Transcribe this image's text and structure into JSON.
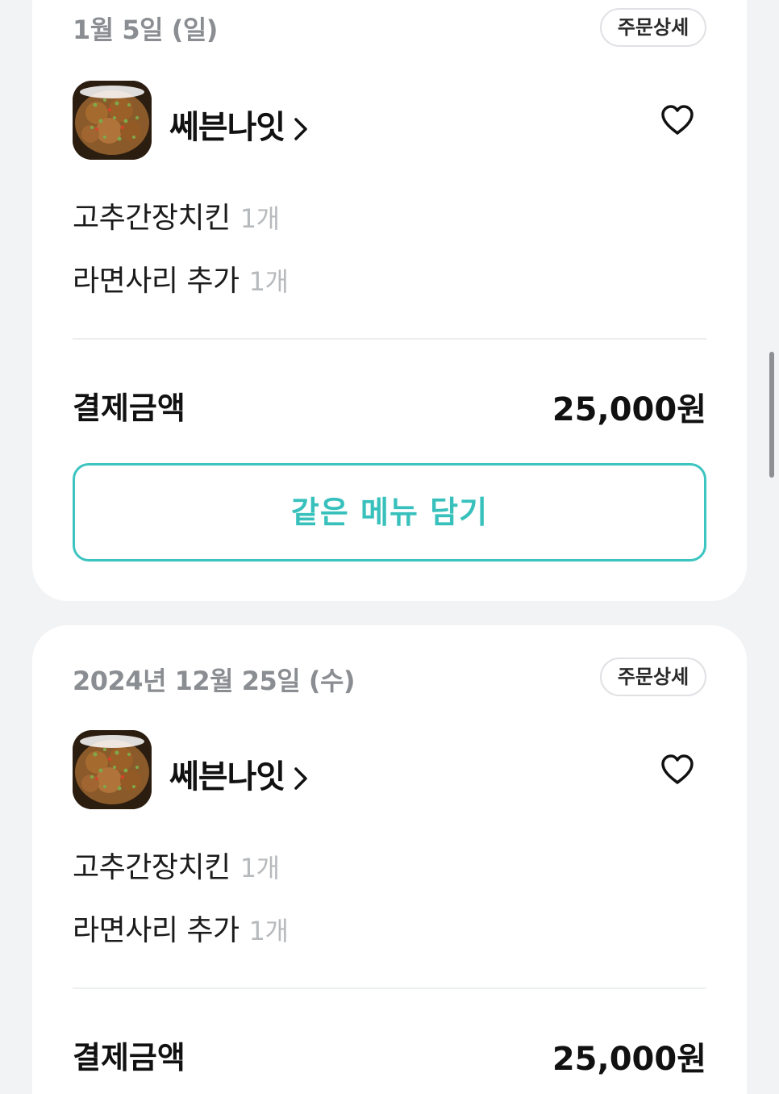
{
  "orders": [
    {
      "date": "1월 5일 (일)",
      "detail_label": "주문상세",
      "store_name": "쎄븐나잇",
      "items": [
        {
          "name": "고추간장치킨",
          "qty": "1개"
        },
        {
          "name": "라면사리 추가",
          "qty": "1개"
        }
      ],
      "payment_label": "결제금액",
      "payment_amount": "25,000원",
      "reorder_label": "같은 메뉴 담기"
    },
    {
      "date": "2024년 12월 25일 (수)",
      "detail_label": "주문상세",
      "store_name": "쎄븐나잇",
      "items": [
        {
          "name": "고추간장치킨",
          "qty": "1개"
        },
        {
          "name": "라면사리 추가",
          "qty": "1개"
        }
      ],
      "payment_label": "결제금액",
      "payment_amount": "25,000원"
    }
  ],
  "icons": {
    "heart": "heart-outline-icon",
    "chevron": "chevron-right-icon"
  },
  "colors": {
    "accent": "#38c1bc",
    "background": "#f2f3f5",
    "muted_text": "#8a8d91"
  }
}
